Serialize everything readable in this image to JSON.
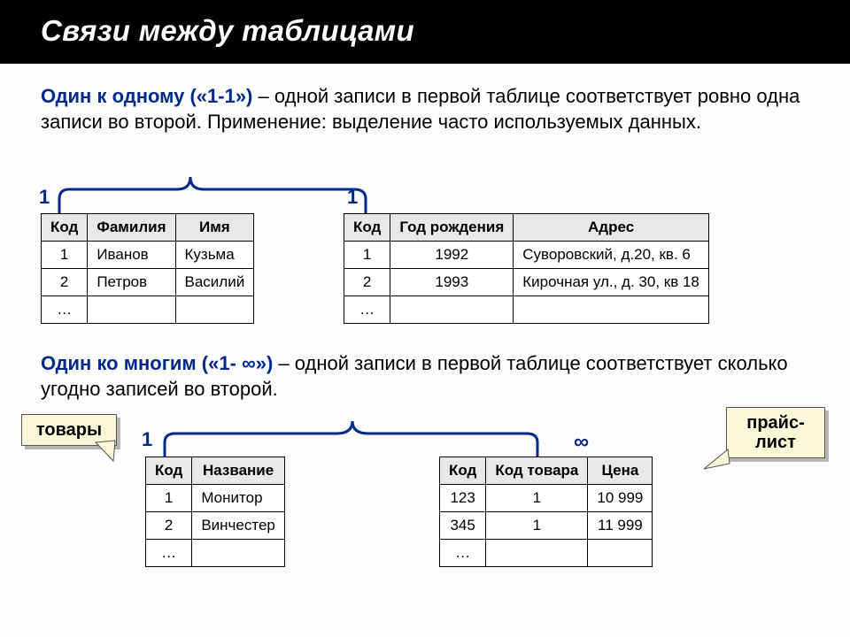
{
  "title": "Связи между таблицами",
  "section1": {
    "bold": "Один к одному («1-1»)",
    "rest": " – одной записи в первой таблице соответствует ровно одна записи во второй. Применение: выделение часто используемых данных."
  },
  "rel1": {
    "left": "1",
    "right": "1"
  },
  "tableA": {
    "headers": [
      "Код",
      "Фамилия",
      "Имя"
    ],
    "rows": [
      [
        "1",
        "Иванов",
        "Кузьма"
      ],
      [
        "2",
        "Петров",
        "Василий"
      ],
      [
        "…",
        "",
        ""
      ]
    ]
  },
  "tableB": {
    "headers": [
      "Код",
      "Год рождения",
      "Адрес"
    ],
    "rows": [
      [
        "1",
        "1992",
        "Суворовский, д.20, кв. 6"
      ],
      [
        "2",
        "1993",
        "Кирочная ул., д. 30, кв 18"
      ],
      [
        "…",
        "",
        ""
      ]
    ]
  },
  "section2": {
    "bold": "Один ко многим («1- ∞»)",
    "rest": " – одной записи в первой таблице соответствует сколько угодно записей во второй."
  },
  "rel2": {
    "left": "1",
    "right": "∞"
  },
  "callout_left": "товары",
  "callout_right_l1": "прайс-",
  "callout_right_l2": "лист",
  "tableC": {
    "headers": [
      "Код",
      "Название"
    ],
    "rows": [
      [
        "1",
        "Монитор"
      ],
      [
        "2",
        "Винчестер"
      ],
      [
        "…",
        ""
      ]
    ]
  },
  "tableD": {
    "headers": [
      "Код",
      "Код товара",
      "Цена"
    ],
    "rows": [
      [
        "123",
        "1",
        "10 999"
      ],
      [
        "345",
        "1",
        "11 999"
      ],
      [
        "…",
        "",
        ""
      ]
    ]
  }
}
